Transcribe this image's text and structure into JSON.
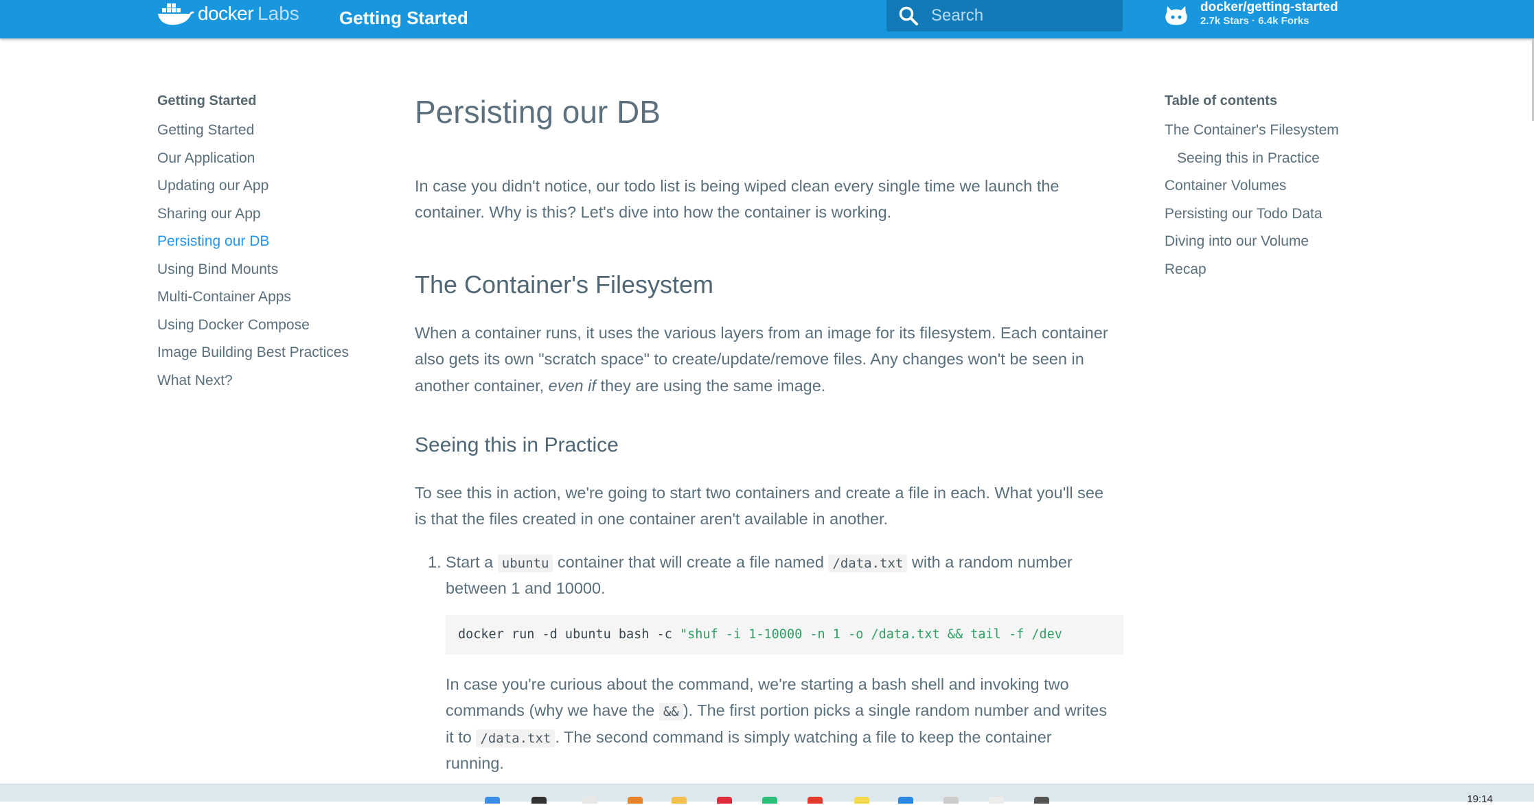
{
  "header": {
    "logo_word": "docker",
    "logo_suffix": "Labs",
    "site_title": "Getting Started",
    "search_placeholder": "Search",
    "repo_name": "docker/getting-started",
    "repo_stats": "2.7k Stars · 6.4k Forks"
  },
  "leftnav": {
    "heading": "Getting Started",
    "items": [
      {
        "label": "Getting Started"
      },
      {
        "label": "Our Application"
      },
      {
        "label": "Updating our App"
      },
      {
        "label": "Sharing our App"
      },
      {
        "label": "Persisting our DB"
      },
      {
        "label": "Using Bind Mounts"
      },
      {
        "label": "Multi-Container Apps"
      },
      {
        "label": "Using Docker Compose"
      },
      {
        "label": "Image Building Best Practices"
      },
      {
        "label": "What Next?"
      }
    ],
    "active_index": 4
  },
  "main": {
    "title": "Persisting our DB",
    "intro_1": "In case you didn't notice, our todo list is being wiped clean every single time we launch the",
    "intro_2": "container. Why is this? Let's dive into how the container is working.",
    "h2_filesystem": "The Container's Filesystem",
    "fs_p1": "When a container runs, it uses the various layers from an image for its filesystem. Each container",
    "fs_p2": "also gets its own \"scratch space\" to create/update/remove files. Any changes won't be seen in",
    "fs_p3_a": "another container, ",
    "fs_p3_em": "even if",
    "fs_p3_b": " they are using the same image.",
    "h3_practice": "Seeing this in Practice",
    "pr_p1": "To see this in action, we're going to start two containers and create a file in each. What you'll see",
    "pr_p2": "is that the files created in one container aren't available in another.",
    "step1": {
      "number": "1.",
      "a": "Start a ",
      "code1": "ubuntu",
      "b": " container that will create a file named ",
      "code2": "/data.txt",
      "c": " with a random number",
      "line2": "between 1 and 10000."
    },
    "codeblock": {
      "plain": "docker run -d ubuntu bash -c ",
      "string": "\"shuf -i 1-10000 -n 1 -o /data.txt && tail -f /dev"
    },
    "explain": {
      "l1": "In case you're curious about the command, we're starting a bash shell and invoking two",
      "l2_a": "commands (why we have the ",
      "l2_code": "&&",
      "l2_b": "). The first portion picks a single random number and writes",
      "l3_a": "it to ",
      "l3_code": "/data.txt",
      "l3_b": ". The second command is simply watching a file to keep the container",
      "l4": "running."
    }
  },
  "toc": {
    "heading": "Table of contents",
    "items": [
      {
        "label": "The Container's Filesystem",
        "sub": false
      },
      {
        "label": "Seeing this in Practice",
        "sub": true
      },
      {
        "label": "Container Volumes",
        "sub": false
      },
      {
        "label": "Persisting our Todo Data",
        "sub": false
      },
      {
        "label": "Diving into our Volume",
        "sub": false
      },
      {
        "label": "Recap",
        "sub": false
      }
    ]
  },
  "taskbar": {
    "clock": "19:14"
  },
  "colors": {
    "header_bg": "#1997de",
    "search_bg": "#137ab8",
    "active_link": "#2196f3",
    "code_string": "#2e9f63"
  }
}
